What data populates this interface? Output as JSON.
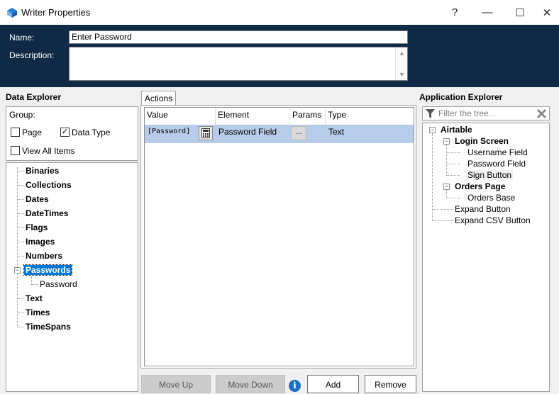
{
  "window": {
    "title": "Writer Properties",
    "help": "?",
    "minimize": "—",
    "maximize": "☐",
    "close": "✕"
  },
  "header": {
    "name_label": "Name:",
    "name_value": "Enter Password",
    "description_label": "Description:",
    "description_value": ""
  },
  "data_explorer": {
    "title": "Data Explorer",
    "group_label": "Group:",
    "page": {
      "label": "Page",
      "checked": false
    },
    "data_type": {
      "label": "Data Type",
      "checked": true
    },
    "view_all": {
      "label": "View All Items",
      "checked": false
    },
    "items": [
      "Binaries",
      "Collections",
      "Dates",
      "DateTimes",
      "Flags",
      "Images",
      "Numbers",
      "Passwords",
      "Password",
      "Text",
      "Times",
      "TimeSpans"
    ]
  },
  "actions": {
    "tab": "Actions",
    "columns": [
      "Value",
      "Element",
      "Params",
      "Type"
    ],
    "row": {
      "value": "[Password]",
      "element": "Password Field",
      "params": "...",
      "type": "Text"
    },
    "buttons": {
      "move_up": "Move Up",
      "move_down": "Move Down",
      "add": "Add",
      "remove": "Remove"
    },
    "info": "i"
  },
  "application_explorer": {
    "title": "Application Explorer",
    "filter_placeholder": "Filter the tree...",
    "items": [
      "Airtable",
      "Login Screen",
      "Username Field",
      "Password Field",
      "Sign Button",
      "Orders Page",
      "Orders Base",
      "Expand Button",
      "Expand CSV Button"
    ]
  },
  "colors": {
    "header_bg": "#0e2a47",
    "selection": "#0078d7",
    "row_highlight": "#b7cbea"
  }
}
